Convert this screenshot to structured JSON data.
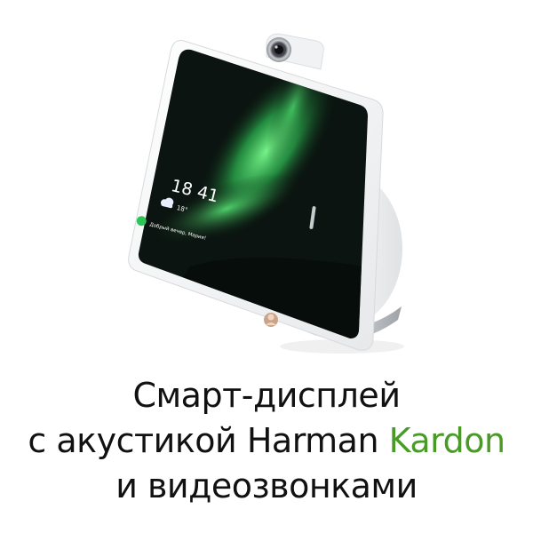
{
  "colors": {
    "background": "#ffffff",
    "text": "#111111",
    "accent": "#4a9a2a",
    "device_body": "#f2f3f4",
    "screen": "#0b1410",
    "aurora": "#3fd86a",
    "assistant_button": "#2fc45a"
  },
  "screen": {
    "time": "18 41",
    "weather": "18°",
    "greeting": "Добрый вечер, Мария!"
  },
  "icons": {
    "camera": "camera-icon",
    "weather": "weather-cloud-icon",
    "assistant": "assistant-button-icon",
    "avatar": "avatar"
  },
  "headline": {
    "line1": "Смарт-дисплей",
    "line2_prefix": "с акустикой ",
    "line2_brand_a": "Harman",
    "line2_brand_b": "Kardon",
    "line3": "и видеозвонками"
  }
}
